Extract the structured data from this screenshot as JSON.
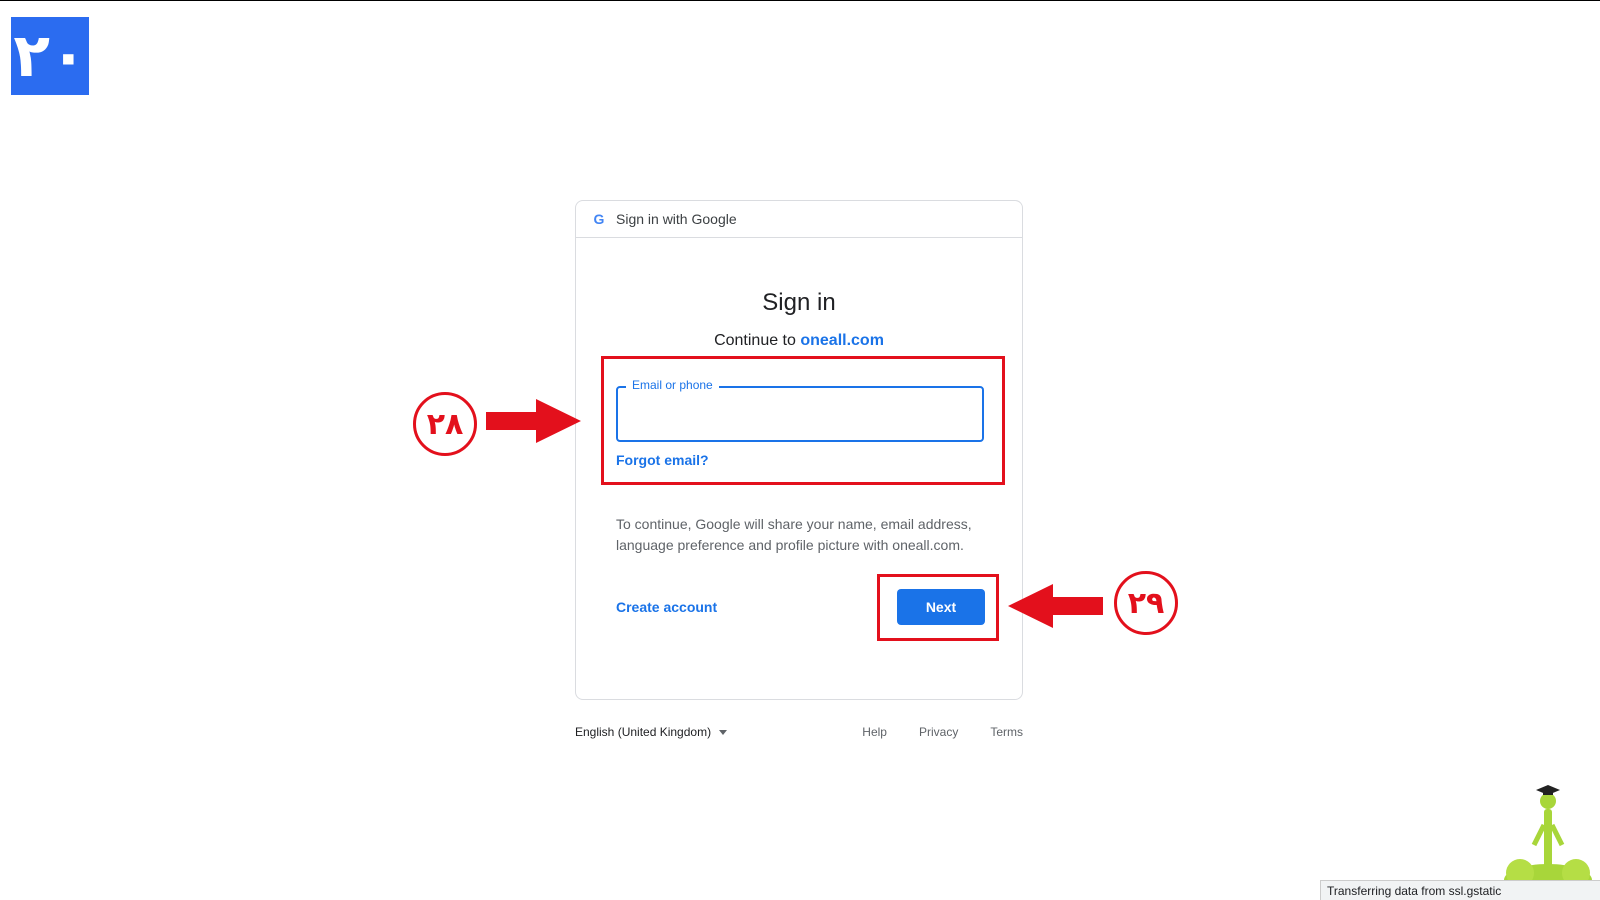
{
  "step_badge": "٢٠",
  "card": {
    "header_icon": "G",
    "header_text": "Sign in with Google",
    "title": "Sign in",
    "subtitle_prefix": "Continue to ",
    "subtitle_site": "oneall.com",
    "email_field": {
      "label": "Email or phone",
      "value": ""
    },
    "forgot_link": "Forgot email?",
    "notice": "To continue, Google will share your name, email address, language preference and profile picture with oneall.com.",
    "create_account": "Create account",
    "next_button": "Next"
  },
  "footer": {
    "language": "English (United Kingdom)",
    "links": [
      "Help",
      "Privacy",
      "Terms"
    ]
  },
  "annotations": {
    "email_step": "۲۸",
    "next_step": "۲۹",
    "color": "#e3101c"
  },
  "status_bar": "Transferring data from ssl.gstatic",
  "colors": {
    "primary": "#1a73e8",
    "badge": "#2b6cf0",
    "highlight": "#e3101c"
  },
  "icons": {
    "google": "google-g-icon",
    "caret": "caret-down-icon",
    "mascot": "graduate-mascot-icon"
  }
}
